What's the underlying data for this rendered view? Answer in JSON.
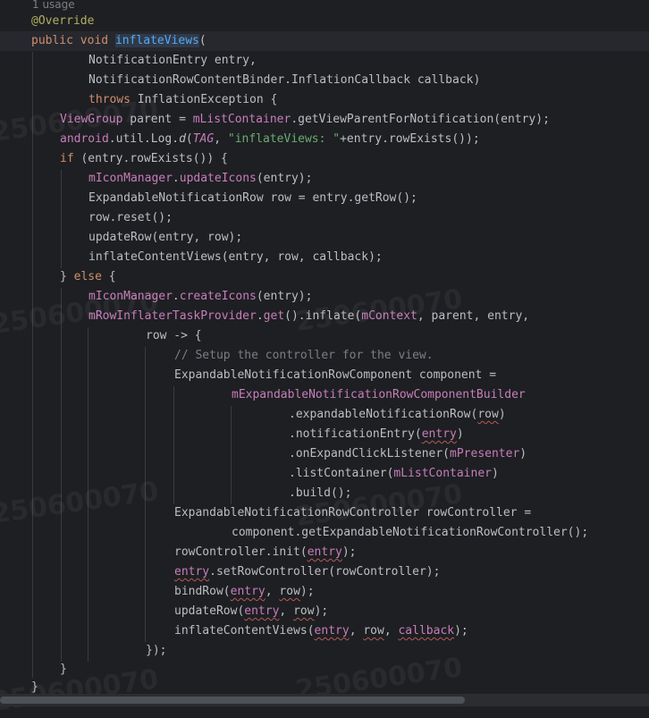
{
  "editor": {
    "usage_hint": "1 usage",
    "watermark": "250600070",
    "lines": {
      "l0": "@Override",
      "l1_public": "public",
      "l1_void": "void",
      "l1_name": "inflateViews",
      "l1_paren": "(",
      "l2": "NotificationEntry entry,",
      "l3": "NotificationRowContentBinder.InflationCallback callback)",
      "l4_throws": "throws",
      "l4_rest": " InflationException {",
      "l5_type": "ViewGroup",
      "l5_a": " parent = ",
      "l5_field": "mListContainer",
      "l5_b": ".getViewParentForNotification(entry);",
      "l6_a": "android",
      "l6_b": ".util.Log.",
      "l6_c": "d",
      "l6_d": "(",
      "l6_tag": "TAG",
      "l6_e": ", ",
      "l6_str": "\"inflateViews: \"",
      "l6_f": "+entry.rowExists());",
      "l7_if": "if",
      "l7_rest": " (entry.rowExists()) {",
      "l8_field": "mIconManager",
      "l8_dot": ".",
      "l8_method": "updateIcons",
      "l8_rest": "(entry);",
      "l9": "ExpandableNotificationRow row = entry.getRow();",
      "l10": "row.reset();",
      "l11": "updateRow(entry, row);",
      "l12": "inflateContentViews(entry, row, callback);",
      "l13_a": "} ",
      "l13_else": "else",
      "l13_b": " {",
      "l14_field": "mIconManager",
      "l14_dot": ".",
      "l14_method": "createIcons",
      "l14_rest": "(entry);",
      "l15_field": "mRowInflaterTaskProvider",
      "l15_dot": ".",
      "l15_get": "get",
      "l15_a": "().inflate(",
      "l15_ctx": "mContext",
      "l15_b": ", parent, entry,",
      "l16": "row -> {",
      "l17": "// Setup the controller for the view.",
      "l18": "ExpandableNotificationRowComponent component =",
      "l19": "mExpandableNotificationRowComponentBuilder",
      "l20_a": ".expandableNotificationRow(",
      "l20_row": "row",
      "l20_b": ")",
      "l21_a": ".notificationEntry(",
      "l21_entry": "entry",
      "l21_b": ")",
      "l22_a": ".onExpandClickListener(",
      "l22_field": "mPresenter",
      "l22_b": ")",
      "l23_a": ".listContainer(",
      "l23_field": "mListContainer",
      "l23_b": ")",
      "l24": ".build();",
      "l25": "ExpandableNotificationRowController rowController =",
      "l26": "component.getExpandableNotificationRowController();",
      "l27_a": "rowController.init(",
      "l27_entry": "entry",
      "l27_b": ");",
      "l28_entry": "entry",
      "l28_rest": ".setRowController(rowController);",
      "l29_a": "bindRow(",
      "l29_entry": "entry",
      "l29_b": ", ",
      "l29_row": "row",
      "l29_c": ");",
      "l30_a": "updateRow(",
      "l30_entry": "entry",
      "l30_b": ", ",
      "l30_row": "row",
      "l30_c": ");",
      "l31_a": "inflateContentViews(",
      "l31_entry": "entry",
      "l31_b": ", ",
      "l31_row": "row",
      "l31_c": ", ",
      "l31_cb": "callback",
      "l31_d": ");",
      "l32": "});",
      "l33": "}",
      "l34": "}"
    }
  },
  "colors": {
    "background": "#1e1f22",
    "keyword": "#cf8e6d",
    "annotation": "#b3ae60",
    "method_declaration": "#56a8f5",
    "field": "#c77dbb",
    "string": "#6aab73",
    "comment": "#7a7e85"
  }
}
